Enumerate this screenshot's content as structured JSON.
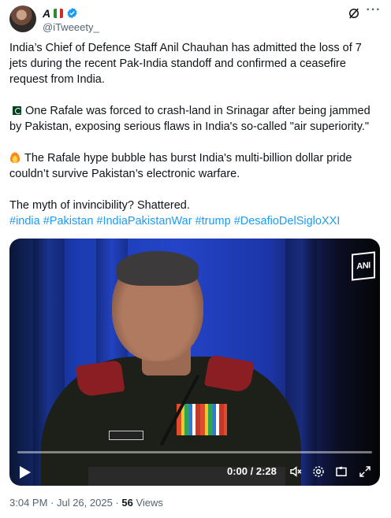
{
  "author": {
    "name": "A",
    "handle": "@iTweeety_",
    "verified": true
  },
  "icons": {
    "grok": "grok-icon",
    "more": "more-icon"
  },
  "tweet": {
    "para1": "India’s Chief of Defence Staff Anil Chauhan has admitted the loss of 7 jets during the recent Pak-India standoff and confirmed a ceasefire request from India.",
    "para2": "One Rafale was forced to crash-land in Srinagar after being jammed by Pakistan, exposing serious flaws in India's so-called \"air superiority.\"",
    "para3": "The Rafale hype bubble has burst India's multi-billion dollar pride couldn’t survive Pakistan’s electronic warfare.",
    "para4": "The myth of invincibility? Shattered.",
    "hashtags": [
      "#india",
      "#Pakistan",
      "#IndiaPakistanWar",
      "#trump",
      "#DesafioDelSigloXXI"
    ]
  },
  "video": {
    "watermark": "ANI",
    "time": "0:00 / 2:28",
    "progress": 0
  },
  "footer": {
    "timestamp": "3:04 PM · Jul 26, 2025 · ",
    "views_count": "56",
    "views_label": " Views"
  },
  "colors": {
    "link": "#1d9bf0",
    "verified": "#1d9bf0",
    "muted": "#536471"
  }
}
